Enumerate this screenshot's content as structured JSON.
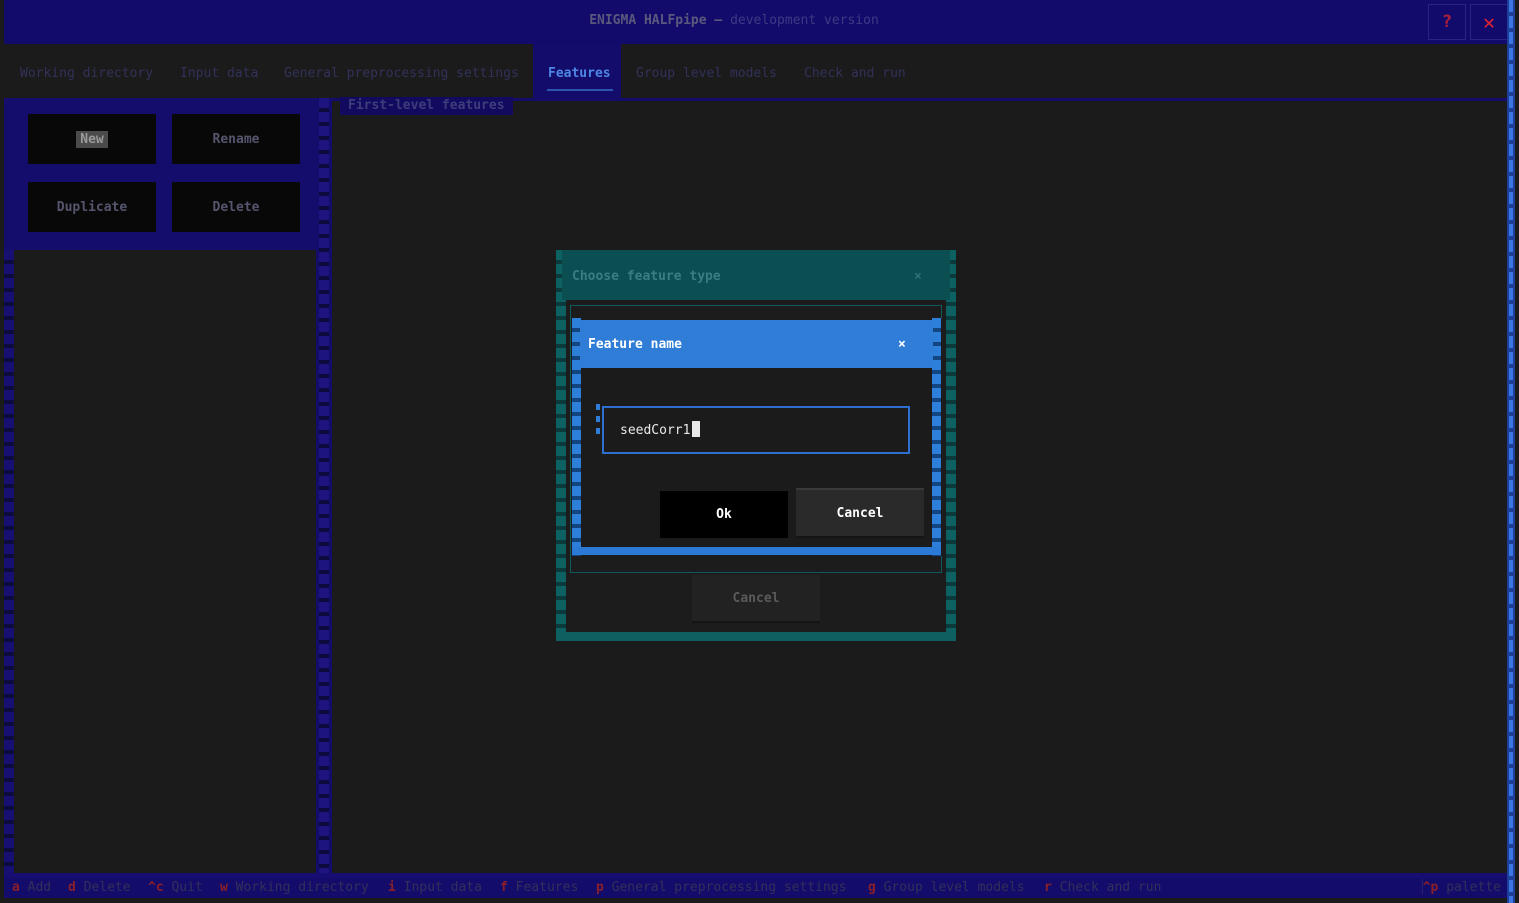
{
  "header": {
    "title": "ENIGMA HALFpipe",
    "separator": "—",
    "subtitle": "development version",
    "help_label": "?",
    "close_label": "✕"
  },
  "tabs": [
    {
      "label": "Working directory",
      "active": false
    },
    {
      "label": "Input data",
      "active": false
    },
    {
      "label": "General preprocessing settings",
      "active": false
    },
    {
      "label": "Features",
      "active": true
    },
    {
      "label": "Group level models",
      "active": false
    },
    {
      "label": "Check and run",
      "active": false
    }
  ],
  "left_panel": {
    "new_label": "New",
    "rename_label": "Rename",
    "duplicate_label": "Duplicate",
    "delete_label": "Delete"
  },
  "main": {
    "section_label": "First-level features"
  },
  "outer_dialog": {
    "title": "Choose feature type",
    "close_icon": "×",
    "cancel_label": "Cancel"
  },
  "inner_dialog": {
    "title": "Feature name",
    "close_icon": "×",
    "input_value": "seedCorr1",
    "ok_label": "Ok",
    "cancel_label": "Cancel"
  },
  "footer": {
    "bindings": [
      {
        "key": "a",
        "label": "Add"
      },
      {
        "key": "d",
        "label": "Delete"
      },
      {
        "key": "^c",
        "label": "Quit"
      },
      {
        "key": "w",
        "label": "Working directory"
      },
      {
        "key": "i",
        "label": "Input data"
      },
      {
        "key": "f",
        "label": "Features"
      },
      {
        "key": "p",
        "label": "General preprocessing settings"
      },
      {
        "key": "g",
        "label": "Group level models"
      },
      {
        "key": "r",
        "label": "Check and run"
      }
    ],
    "palette_key": "^p",
    "palette_label": "palette"
  },
  "colors": {
    "header_bg": "#120b6c",
    "inner_dialog_accent": "#2f7dd6",
    "outer_dialog_accent": "#0e6161",
    "close_icon": "#e3222e"
  }
}
